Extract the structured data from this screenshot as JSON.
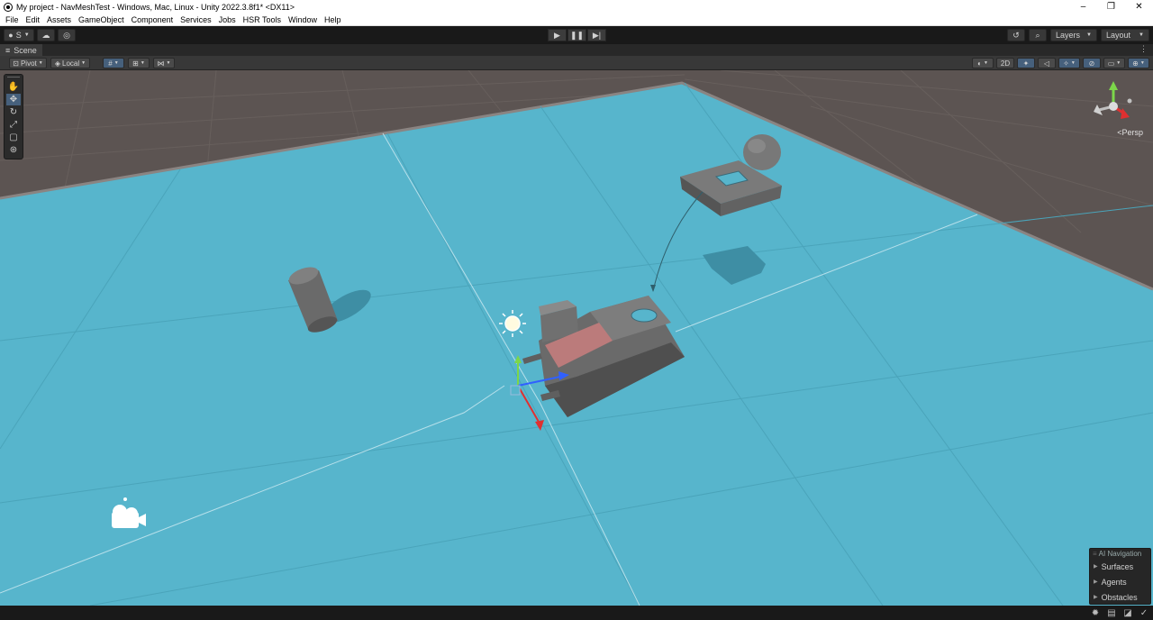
{
  "window": {
    "title": "My project - NavMeshTest - Windows, Mac, Linux - Unity 2022.3.8f1* <DX11>",
    "controls": [
      "–",
      "❐",
      "✕"
    ]
  },
  "menu": [
    "File",
    "Edit",
    "Assets",
    "GameObject",
    "Component",
    "Services",
    "Jobs",
    "HSR Tools",
    "Window",
    "Help"
  ],
  "toolbar": {
    "account_label": "S",
    "layers_label": "Layers",
    "layout_label": "Layout"
  },
  "scene_tab": {
    "label": "Scene"
  },
  "scene_tools": {
    "pivot_label": "Pivot",
    "local_label": "Local",
    "two_d_label": "2D"
  },
  "viewport": {
    "persp_label": "<Persp"
  },
  "ai_navigation": {
    "title": "AI Navigation",
    "items": [
      "Surfaces",
      "Agents",
      "Obstacles"
    ]
  },
  "colors": {
    "navmesh": "#57b5cc",
    "ground": "#5c5452",
    "selection_accent": "#46607c"
  }
}
